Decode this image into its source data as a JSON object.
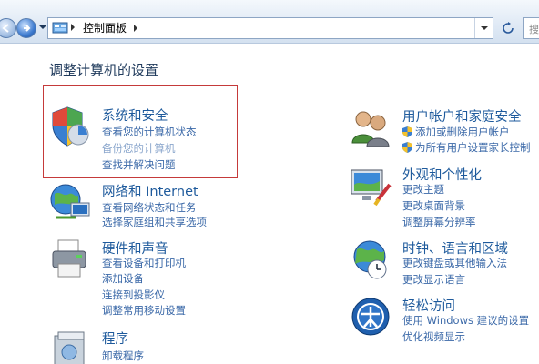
{
  "address": {
    "path": "控制面板"
  },
  "search": {
    "placeholder": "搜索控"
  },
  "heading": "调整计算机的设置",
  "left_categories": [
    {
      "title": "系统和安全",
      "links": [
        "查看您的计算机状态",
        "备份您的计算机",
        "查找并解决问题"
      ]
    },
    {
      "title": "网络和 Internet",
      "links": [
        "查看网络状态和任务",
        "选择家庭组和共享选项"
      ]
    },
    {
      "title": "硬件和声音",
      "links": [
        "查看设备和打印机",
        "添加设备",
        "连接到投影仪",
        "调整常用移动设置"
      ]
    },
    {
      "title": "程序",
      "links": [
        "卸载程序"
      ]
    }
  ],
  "right_categories": [
    {
      "title": "用户帐户和家庭安全",
      "links": [
        "添加或删除用户帐户",
        "为所有用户设置家长控制"
      ]
    },
    {
      "title": "外观和个性化",
      "links": [
        "更改主题",
        "更改桌面背景",
        "调整屏幕分辨率"
      ]
    },
    {
      "title": "时钟、语言和区域",
      "links": [
        "更改键盘或其他输入法",
        "更改显示语言"
      ]
    },
    {
      "title": "轻松访问",
      "links": [
        "使用 Windows 建议的设置",
        "优化视频显示"
      ]
    }
  ],
  "colors": {
    "link": "#3b69a8",
    "title": "#1e5a9c",
    "highlight_border": "#c53a3a"
  }
}
